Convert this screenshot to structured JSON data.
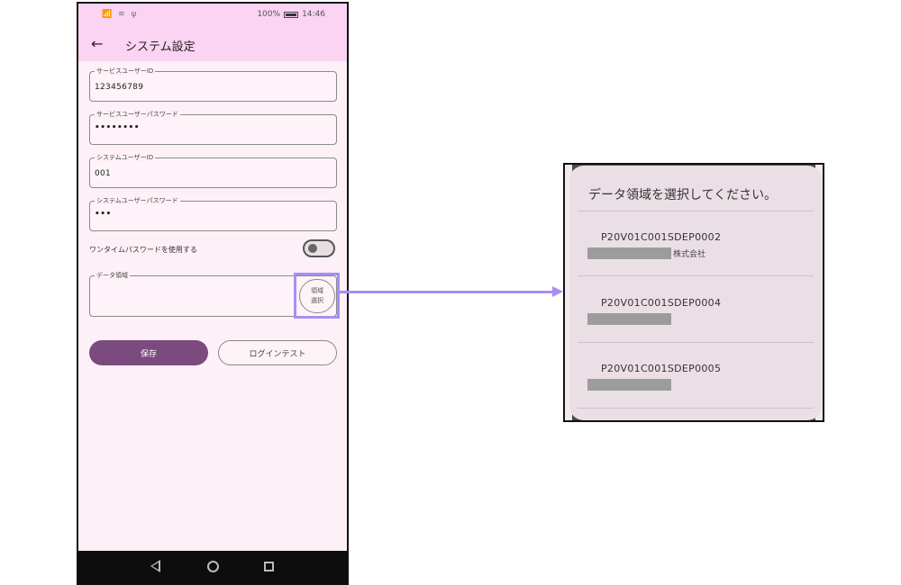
{
  "status_bar": {
    "left_icons": "📶 ≋ ψ",
    "battery": "100%",
    "time": "14:46"
  },
  "app_bar": {
    "title": "システム設定"
  },
  "form": {
    "service_user_id": {
      "label": "サービスユーザーID",
      "value": "123456789"
    },
    "service_user_password": {
      "label": "サービスユーザーパスワード",
      "value": "••••••••"
    },
    "system_user_id": {
      "label": "システムユーザーID",
      "value": "001"
    },
    "system_user_password": {
      "label": "システムユーザーパスワード",
      "value": "•••"
    },
    "one_time_password": {
      "label": "ワンタイムパスワードを使用する",
      "enabled": false
    },
    "data_region": {
      "label": "データ領域",
      "value": "",
      "button_line1": "領域",
      "button_line2": "選択"
    }
  },
  "buttons": {
    "save": "保存",
    "login_test": "ログインテスト"
  },
  "dialog": {
    "title": "データ領域を選択してください。",
    "items": [
      {
        "code": "P20V01C001SDEP0002",
        "suffix": "株式会社"
      },
      {
        "code": "P20V01C001SDEP0004",
        "suffix": ""
      },
      {
        "code": "P20V01C001SDEP0005",
        "suffix": ""
      }
    ]
  },
  "colors": {
    "accent": "#a78ef5",
    "primary_button": "#7b4a7e",
    "app_bar": "#fbd3f3"
  }
}
